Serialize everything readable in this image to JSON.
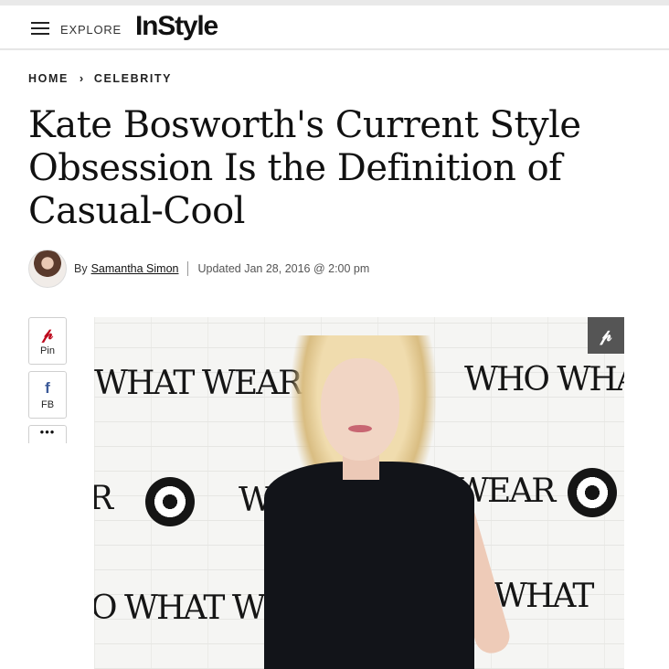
{
  "header": {
    "menu_icon": "hamburger-icon",
    "explore_label": "EXPLORE",
    "logo_text": "InStyle"
  },
  "breadcrumb": {
    "home": "HOME",
    "separator_icon": "chevron-right-icon",
    "separator": "›",
    "section": "CELEBRITY"
  },
  "article": {
    "title": "Kate Bosworth's Current Style Obsession Is the Definition of Casual-Cool",
    "byline": {
      "by": "By",
      "author": "Samantha Simon",
      "updated": "Updated Jan 28, 2016 @ 2:00 pm"
    }
  },
  "share": {
    "pinterest": {
      "icon": "pinterest-icon",
      "glyph": "𝓅",
      "label": "Pin"
    },
    "facebook": {
      "icon": "facebook-icon",
      "glyph": "f",
      "label": "FB"
    },
    "more": {
      "icon": "more-icon",
      "glyph": "•••"
    }
  },
  "photo": {
    "pin_icon": "pinterest-icon",
    "pin_glyph": "𝓅",
    "wall_text": {
      "top_left": "WHAT WEAR",
      "top_right": "WHO WHA",
      "mid_left": "R",
      "mid_center": "W",
      "mid_right": "WEAR",
      "bottom_left": "O WHAT WE",
      "bottom_right": "O WHAT"
    }
  },
  "colors": {
    "pinterest_red": "#bd081c",
    "facebook_blue": "#3b5998",
    "text": "#111111"
  }
}
